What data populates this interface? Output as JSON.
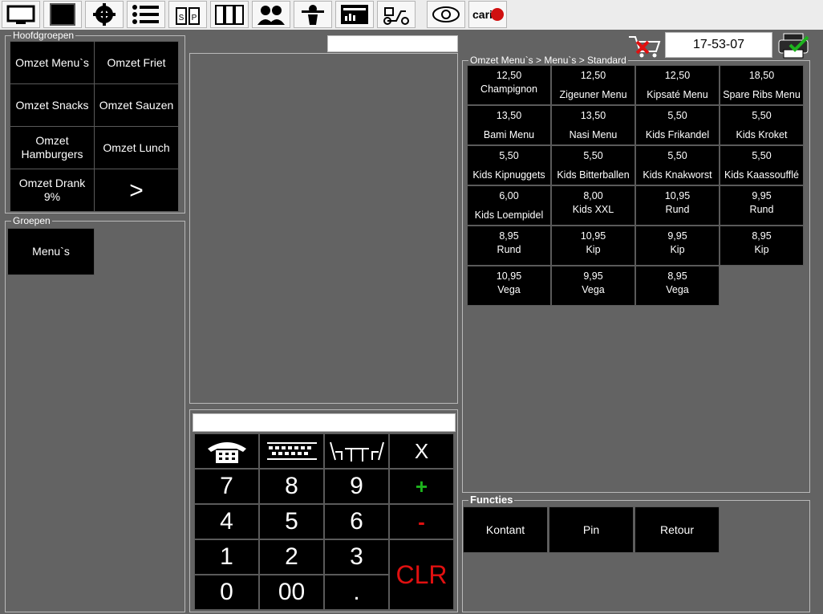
{
  "toolbar": {
    "icons": [
      "monitor-icon",
      "screen-icon",
      "settings-icon",
      "list-icon",
      "salt-pepper-icon",
      "archive-icon",
      "users-icon",
      "waiter-icon",
      "report-icon",
      "delivery-scooter-icon",
      "eye-icon",
      "cariari-logo-icon"
    ],
    "logo_text": "cari"
  },
  "hoofdgroepen": {
    "title": "Hoofdgroepen",
    "items": [
      "Omzet Menu`s",
      "Omzet Friet",
      "Omzet Snacks",
      "Omzet Sauzen",
      "Omzet Hamburgers",
      "Omzet Lunch",
      "Omzet Drank 9%",
      ">"
    ]
  },
  "groepen": {
    "title": "Groepen",
    "items": [
      "Menu`s"
    ]
  },
  "header": {
    "search_value": "",
    "clock": "17-53-07"
  },
  "products": {
    "breadcrumb": "Omzet Menu`s > Menu`s > Standard",
    "items": [
      {
        "price": "12,50",
        "name": "Champignon"
      },
      {
        "price": "12,50",
        "name": "Zigeuner Menu"
      },
      {
        "price": "12,50",
        "name": "Kipsaté Menu"
      },
      {
        "price": "18,50",
        "name": "Spare Ribs Menu"
      },
      {
        "price": "13,50",
        "name": "Bami Menu"
      },
      {
        "price": "13,50",
        "name": "Nasi Menu"
      },
      {
        "price": "5,50",
        "name": "Kids Frikandel"
      },
      {
        "price": "5,50",
        "name": "Kids Kroket"
      },
      {
        "price": "5,50",
        "name": "Kids Kipnuggets"
      },
      {
        "price": "5,50",
        "name": "Kids Bitterballen"
      },
      {
        "price": "5,50",
        "name": "Kids Knakworst"
      },
      {
        "price": "5,50",
        "name": "Kids Kaassoufflé"
      },
      {
        "price": "6,00",
        "name": "Kids Loempidel"
      },
      {
        "price": "8,00",
        "name": "Kids XXL"
      },
      {
        "price": "10,95",
        "name": "Rund"
      },
      {
        "price": "9,95",
        "name": "Rund"
      },
      {
        "price": "8,95",
        "name": "Rund"
      },
      {
        "price": "10,95",
        "name": "Kip"
      },
      {
        "price": "9,95",
        "name": "Kip"
      },
      {
        "price": "8,95",
        "name": "Kip"
      },
      {
        "price": "10,95",
        "name": "Vega"
      },
      {
        "price": "9,95",
        "name": "Vega"
      },
      {
        "price": "8,95",
        "name": "Vega"
      }
    ]
  },
  "keypad": {
    "input_value": "",
    "icons": [
      "telephone-icon",
      "keyboard-icon",
      "table-chairs-icon"
    ],
    "close": "X",
    "digits": [
      "7",
      "8",
      "9",
      "4",
      "5",
      "6",
      "1",
      "2",
      "3",
      "0",
      "00",
      "."
    ],
    "plus": "+",
    "minus": "-",
    "clear": "CLR"
  },
  "functies": {
    "title": "Functies",
    "buttons": [
      "Kontant",
      "Pin",
      "Retour"
    ]
  },
  "colors": {
    "background": "#636363",
    "button": "#000000",
    "plus": "#1db31d",
    "minus_clear": "#e01010"
  }
}
